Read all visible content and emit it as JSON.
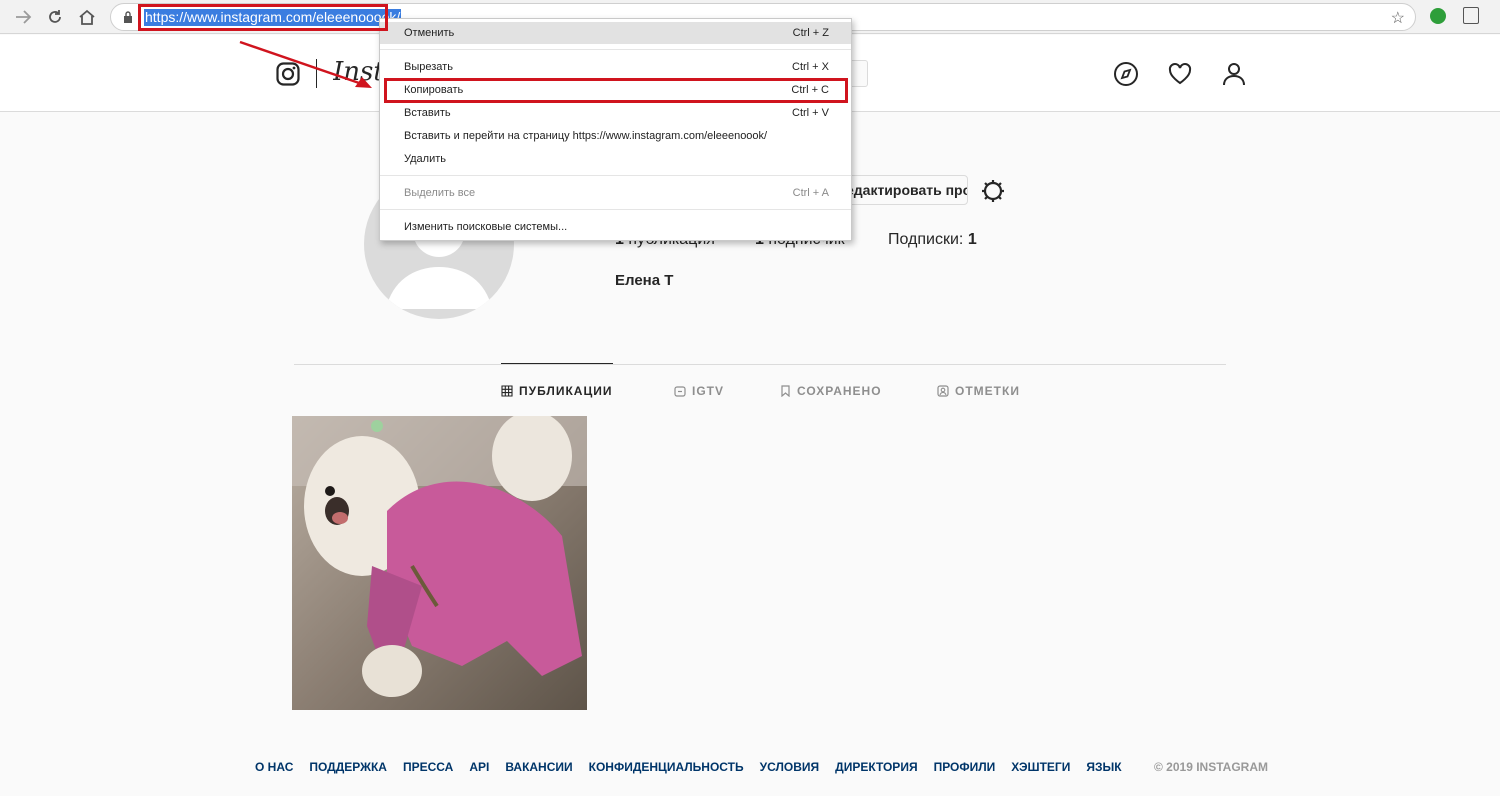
{
  "browser": {
    "url_selected": "https://www.instagram.com/eleeenooook/",
    "back_icon": "back-arrow-icon",
    "reload_icon": "reload-icon",
    "home_icon": "home-icon",
    "star_glyph": "☆"
  },
  "header": {
    "wordmark": "Instagram"
  },
  "context_menu": {
    "undo": {
      "label": "Отменить",
      "shortcut": "Ctrl + Z"
    },
    "cut": {
      "label": "Вырезать",
      "shortcut": "Ctrl + X"
    },
    "copy": {
      "label": "Копировать",
      "shortcut": "Ctrl + C"
    },
    "paste": {
      "label": "Вставить",
      "shortcut": "Ctrl + V"
    },
    "paste_go": {
      "label": "Вставить и перейти на страницу https://www.instagram.com/eleeenoook/"
    },
    "delete": {
      "label": "Удалить"
    },
    "select_all": {
      "label": "Выделить все",
      "shortcut": "Ctrl + A"
    },
    "search_engines": {
      "label": "Изменить поисковые системы..."
    }
  },
  "profile": {
    "edit_button": "Редактировать профиль",
    "posts_count": "1",
    "posts_label": "публикация",
    "followers_count": "1",
    "followers_label": "подписчик",
    "following_label": "Подписки:",
    "following_count": "1",
    "full_name": "Елена Т"
  },
  "tabs": [
    {
      "label": "ПУБЛИКАЦИИ"
    },
    {
      "label": "IGTV"
    },
    {
      "label": "СОХРАНЕНО"
    },
    {
      "label": "ОТМЕТКИ"
    }
  ],
  "footer": {
    "links": [
      "О НАС",
      "ПОДДЕРЖКА",
      "ПРЕССА",
      "API",
      "ВАКАНСИИ",
      "КОНФИДЕНЦИАЛЬНОСТЬ",
      "УСЛОВИЯ",
      "ДИРЕКТОРИЯ",
      "ПРОФИЛИ",
      "ХЭШТЕГИ",
      "ЯЗЫК"
    ],
    "copyright": "© 2019 INSTAGRAM"
  },
  "colors": {
    "annotation_red": "#d0141e",
    "selection_blue": "#3a7de0",
    "footer_link": "#003569"
  }
}
